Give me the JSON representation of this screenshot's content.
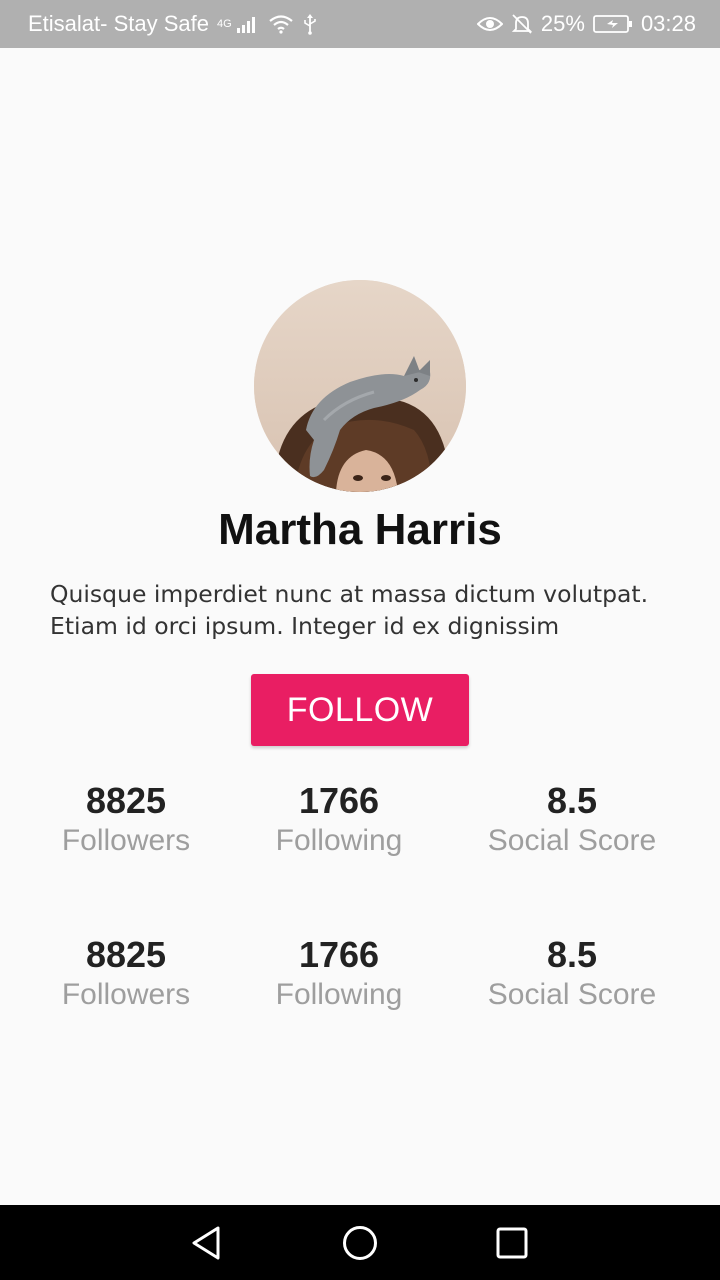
{
  "status_bar": {
    "carrier": "Etisalat- Stay Safe",
    "network": "4G",
    "battery": "25%",
    "time": "03:28",
    "icons": [
      "signal-icon",
      "wifi-icon",
      "usb-icon",
      "eye-icon",
      "bell-off-icon",
      "battery-icon"
    ]
  },
  "profile": {
    "name": "Martha Harris",
    "bio_lines": [
      "Quisque imperdiet nunc at massa dictum volutpat.",
      "Etiam id orci ipsum. Integer id ex dignissim"
    ],
    "follow_label": "FOLLOW"
  },
  "stats_rows": [
    [
      {
        "value": "8825",
        "label": "Followers"
      },
      {
        "value": "1766",
        "label": "Following"
      },
      {
        "value": "8.5",
        "label": "Social Score"
      }
    ],
    [
      {
        "value": "8825",
        "label": "Followers"
      },
      {
        "value": "1766",
        "label": "Following"
      },
      {
        "value": "8.5",
        "label": "Social Score"
      }
    ]
  ],
  "nav": {
    "icons": [
      "back-icon",
      "home-icon",
      "recents-icon"
    ]
  },
  "colors": {
    "accent": "#e91e63",
    "status_bar": "#b0b0b0",
    "background": "#fafafa",
    "label_gray": "#9e9e9e"
  }
}
